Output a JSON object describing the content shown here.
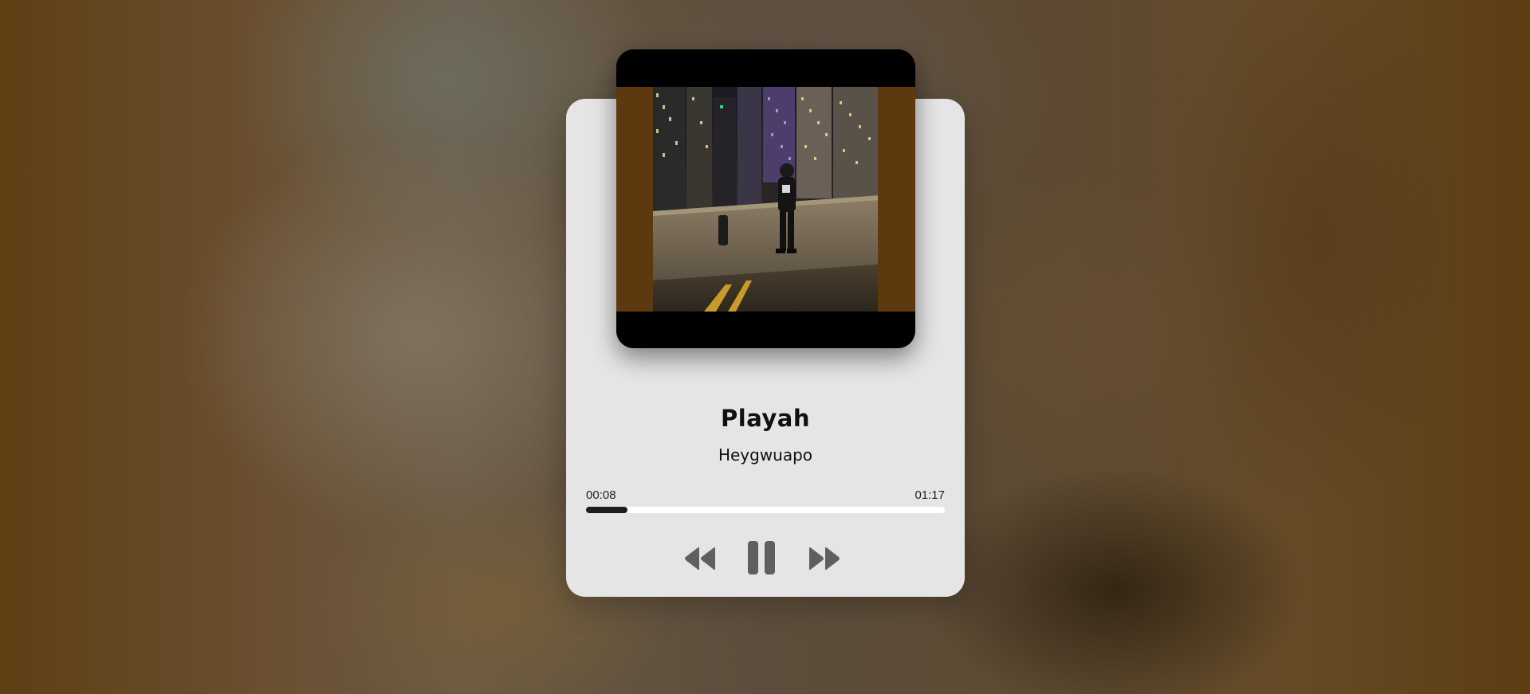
{
  "track": {
    "title": "Playah",
    "artist": "Heygwuapo"
  },
  "progress": {
    "current_time": "00:08",
    "duration": "01:17",
    "fraction": 0.115
  },
  "controls": {
    "rewind_icon": "rewind-icon",
    "pause_icon": "pause-icon",
    "fast_forward_icon": "fast-forward-icon"
  },
  "colors": {
    "card": "#e5e5e5",
    "progress_fill": "#1e1e1e",
    "progress_track": "#ffffff",
    "control_icons": "#5f5f5f",
    "cover_side_bars": "#5e380f"
  }
}
